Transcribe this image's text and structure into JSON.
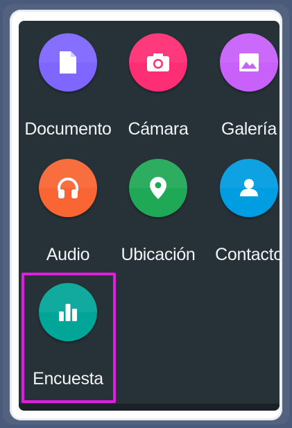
{
  "attach_menu": {
    "items": [
      {
        "label": "Documento",
        "icon": "document-icon",
        "color": "#7f66ff"
      },
      {
        "label": "Cámara",
        "icon": "camera-icon",
        "color": "#fe2e74"
      },
      {
        "label": "Galería",
        "icon": "gallery-icon",
        "color": "#c861fa"
      },
      {
        "label": "Audio",
        "icon": "headphones-icon",
        "color": "#f96533"
      },
      {
        "label": "Ubicación",
        "icon": "location-pin-icon",
        "color": "#1fa855"
      },
      {
        "label": "Contacto",
        "icon": "contact-icon",
        "color": "#009de2"
      },
      {
        "label": "Encuesta",
        "icon": "poll-icon",
        "color": "#02a698"
      }
    ],
    "highlight_color": "#e11ee0",
    "background": "#263238"
  }
}
